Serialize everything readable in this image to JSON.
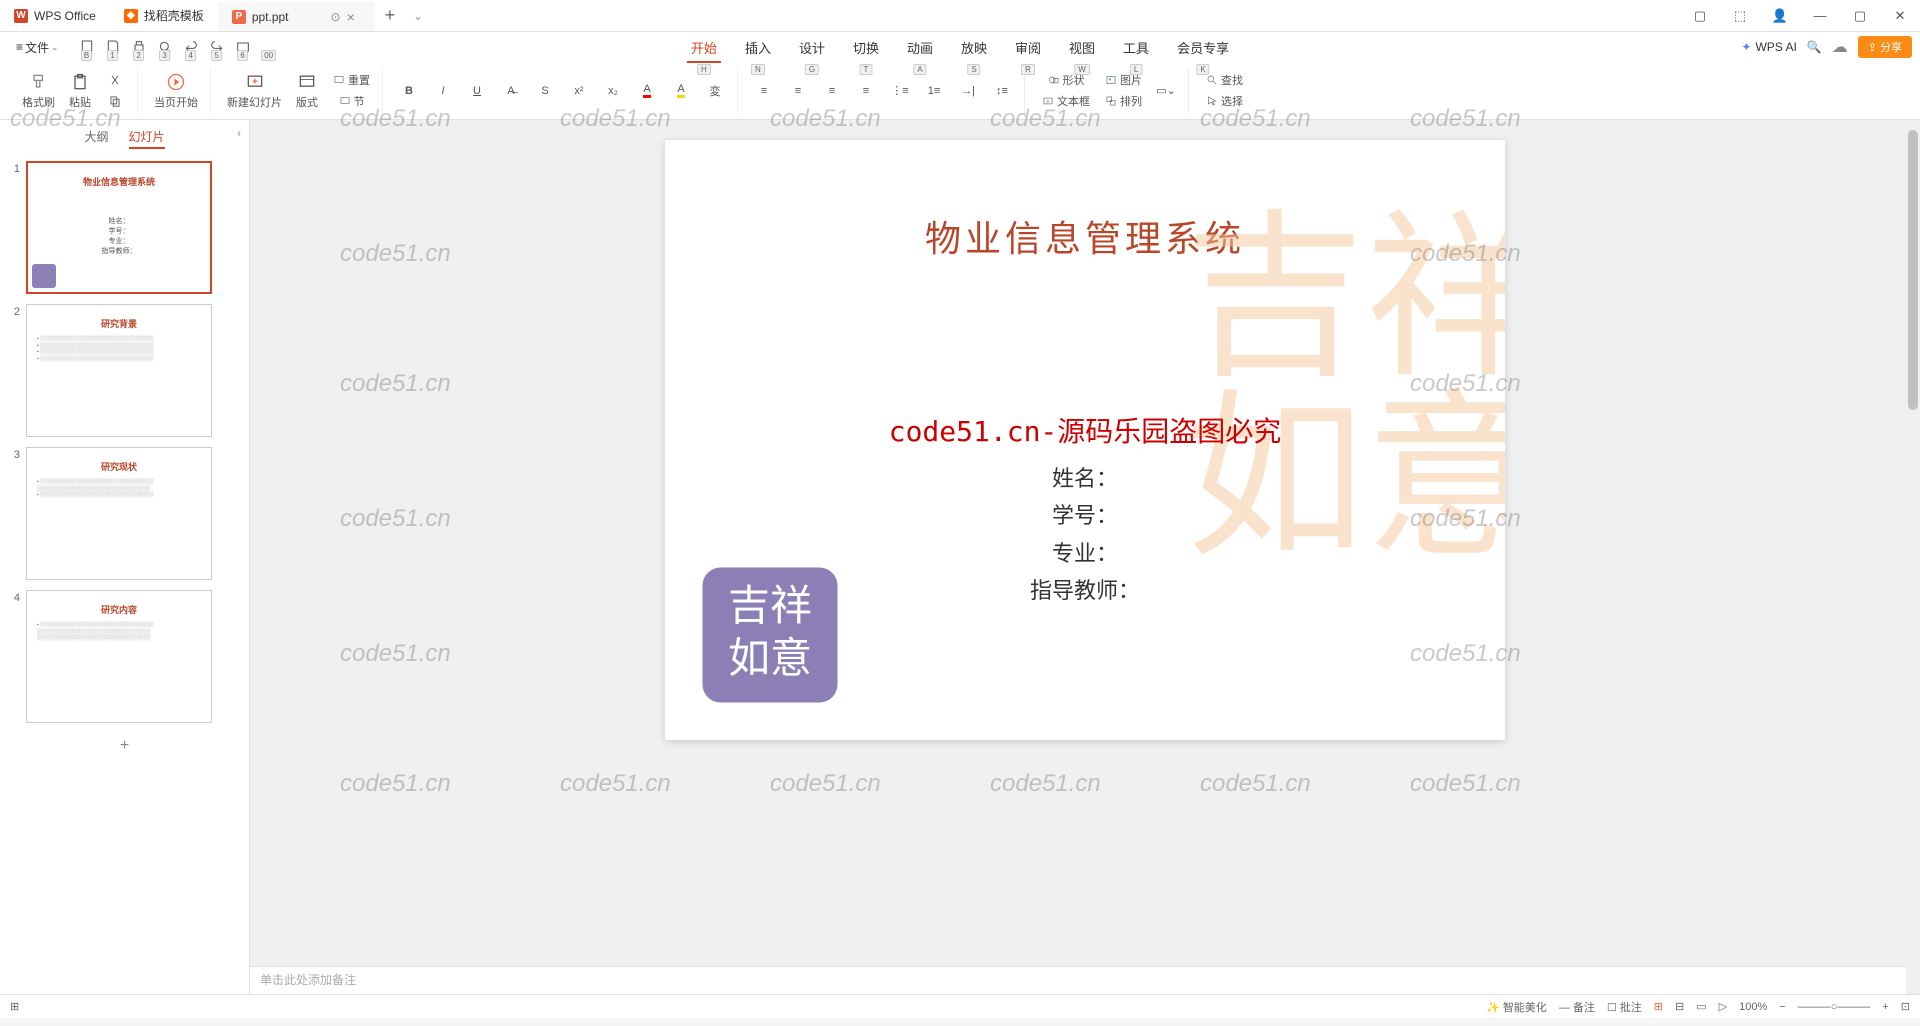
{
  "tabs": {
    "t1": "WPS Office",
    "t2": "找稻壳模板",
    "t3": "ppt.ppt"
  },
  "menu": {
    "file": "文件"
  },
  "qat_keys": [
    "B",
    "1",
    "2",
    "3",
    "4",
    "5",
    "6",
    "00"
  ],
  "ribbon_tabs": {
    "start": {
      "label": "开始",
      "key": "H"
    },
    "insert": {
      "label": "插入",
      "key": "N"
    },
    "design": {
      "label": "设计",
      "key": "G"
    },
    "transition": {
      "label": "切换",
      "key": "T"
    },
    "animation": {
      "label": "动画",
      "key": "A"
    },
    "slideshow": {
      "label": "放映",
      "key": "S"
    },
    "review": {
      "label": "审阅",
      "key": "R"
    },
    "view": {
      "label": "视图",
      "key": "W"
    },
    "tools": {
      "label": "工具",
      "key": "L"
    },
    "vip": {
      "label": "会员专享",
      "key": "K"
    }
  },
  "ai_label": "WPS AI",
  "share_label": "分享",
  "ribbon_buttons": {
    "format_painter": "格式刷",
    "paste": "粘贴",
    "start_from": "当页开始",
    "new_slide": "新建幻灯片",
    "layout": "版式",
    "reset": "重置",
    "section": "节",
    "shape": "形状",
    "picture": "图片",
    "textbox": "文本框",
    "arrange": "排列",
    "find": "查找",
    "select": "选择"
  },
  "side": {
    "outline": "大纲",
    "slides": "幻灯片"
  },
  "thumbs": [
    {
      "num": "1",
      "title": "物业信息管理系统",
      "body": "姓名：\n学号：\n专业：\n指导教师："
    },
    {
      "num": "2",
      "title": "研究背景",
      "body": ""
    },
    {
      "num": "3",
      "title": "研究现状",
      "body": ""
    },
    {
      "num": "4",
      "title": "研究内容",
      "body": ""
    }
  ],
  "slide": {
    "title": "物业信息管理系统",
    "watermark": "code51.cn-源码乐园盗图必究",
    "f1": "姓名：",
    "f2": "学号：",
    "f3": "专业：",
    "f4": "指导教师："
  },
  "notes_placeholder": "单击此处添加备注",
  "status": {
    "smart": "智能美化",
    "notes": "备注",
    "comments": "批注",
    "zoom": "100%"
  },
  "page_wm": "code51.cn"
}
